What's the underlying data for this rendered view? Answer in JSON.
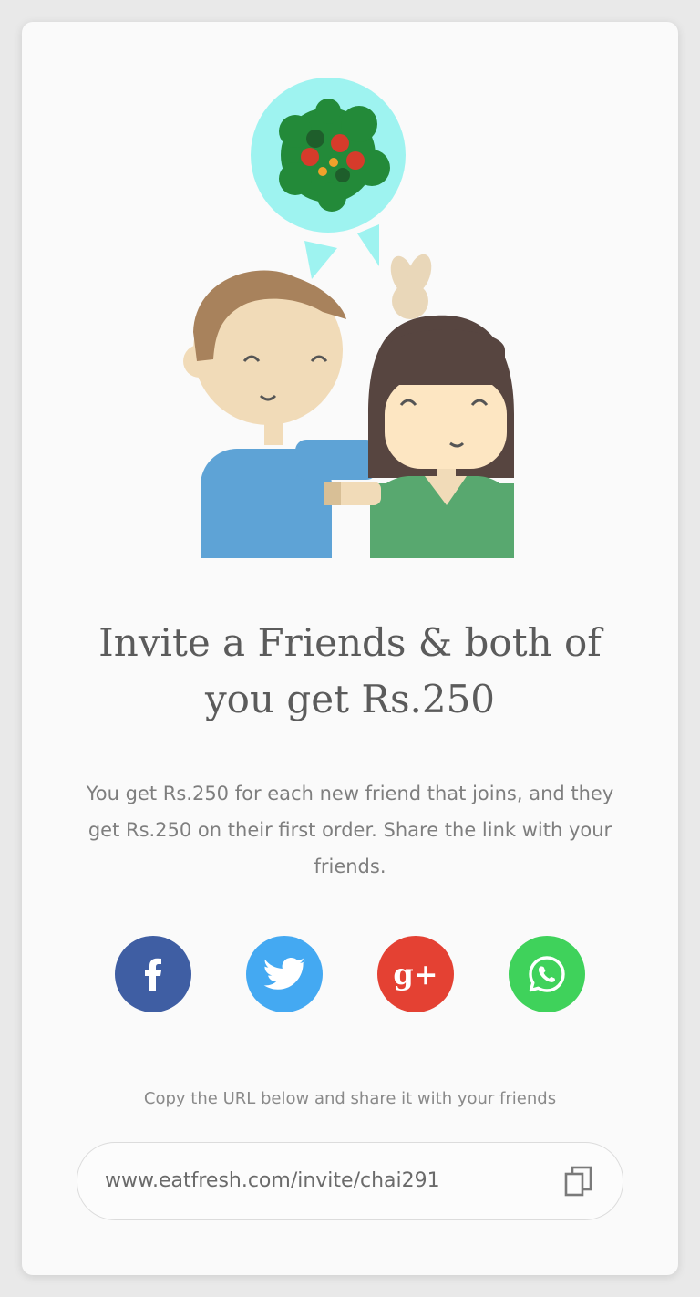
{
  "header": {
    "title": "Invite a Friends & both of you get Rs.250"
  },
  "description": "You get Rs.250 for each new friend that joins, and they get Rs.250 on their first order. Share the link with your friends.",
  "share": {
    "buttons": [
      {
        "name": "facebook",
        "icon": "facebook-icon",
        "color": "#3f5ea3"
      },
      {
        "name": "twitter",
        "icon": "twitter-icon",
        "color": "#44a9f2"
      },
      {
        "name": "google-plus",
        "icon": "google-plus-icon",
        "color": "#e44133"
      },
      {
        "name": "whatsapp",
        "icon": "whatsapp-icon",
        "color": "#3fd25b"
      }
    ],
    "google_plus_label": "g+"
  },
  "copy": {
    "hint": "Copy the URL below and share it with your friends",
    "url": "www.eatfresh.com/invite/chai291",
    "icon": "copy-icon"
  },
  "colors": {
    "bubble": "#9ef3f0",
    "shirt_boy": "#5ea3d6",
    "shirt_girl": "#58a86f",
    "skin": "#f1dbb8",
    "hair_boy": "#a8825c",
    "hair_girl": "#574540"
  }
}
